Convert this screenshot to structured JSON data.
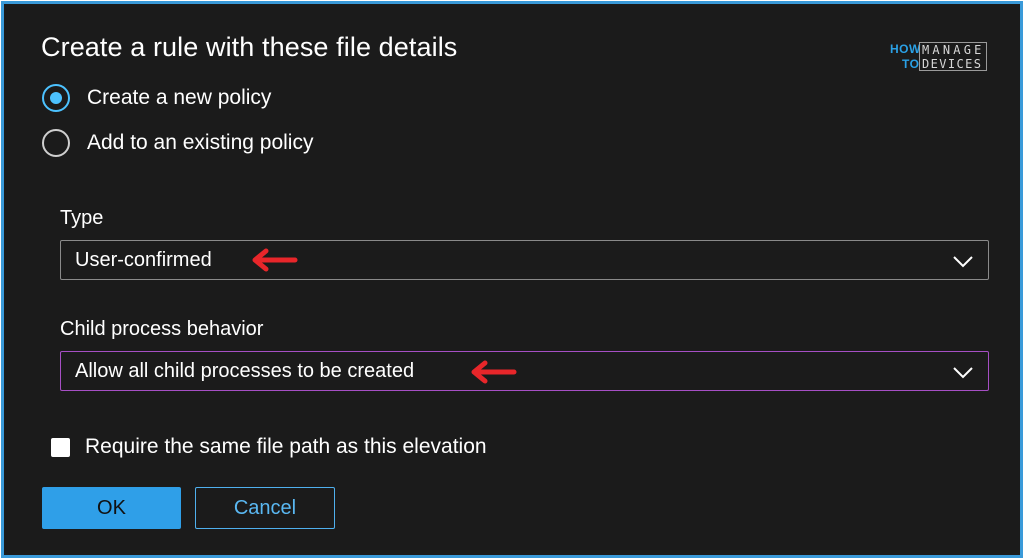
{
  "dialog": {
    "title": "Create a rule with these file details"
  },
  "logo": {
    "how": "HOW",
    "to": "TO",
    "manage": "MANAGE",
    "devices": "DEVICES"
  },
  "policy_options": [
    {
      "label": "Create a new policy",
      "selected": true
    },
    {
      "label": "Add to an existing policy",
      "selected": false
    }
  ],
  "type_field": {
    "label": "Type",
    "value": "User-confirmed"
  },
  "child_process_field": {
    "label": "Child process behavior",
    "value": "Allow all child processes to be created"
  },
  "require_path": {
    "label": "Require the same file path as this elevation",
    "checked": false
  },
  "buttons": {
    "ok": "OK",
    "cancel": "Cancel"
  },
  "colors": {
    "frame_border": "#3a9ad9",
    "background": "#1b1b1b",
    "accent": "#4cc2ff",
    "primary_button": "#2f9fe8",
    "focus_border": "#a64fc4",
    "annotation_arrow": "#e8262a"
  }
}
